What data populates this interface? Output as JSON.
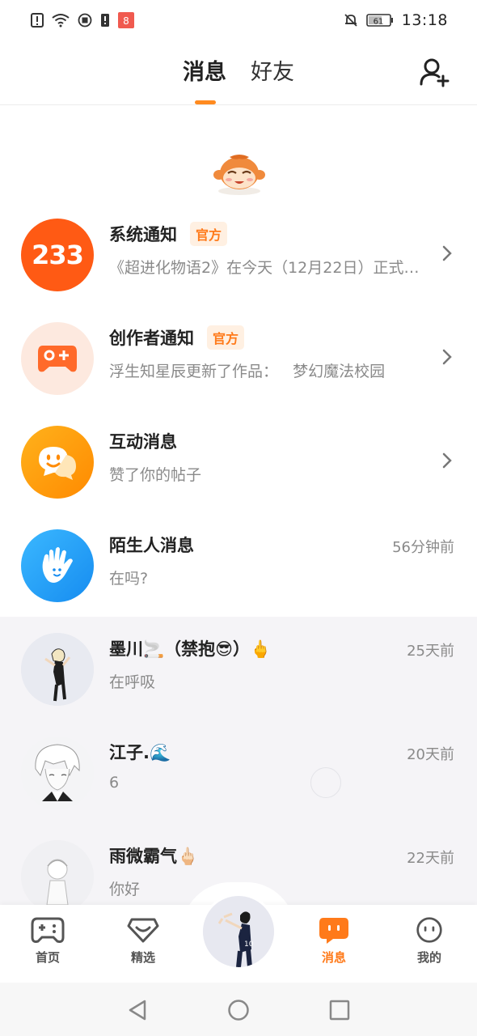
{
  "status_bar": {
    "time": "13:18",
    "battery": "61",
    "icons": [
      "alert-icon",
      "wifi-icon",
      "record-icon",
      "sim-icon",
      "app-badge-icon",
      "mute-bell-icon",
      "battery-icon"
    ]
  },
  "header": {
    "tab_messages": "消息",
    "tab_friends": "好友",
    "active_tab": "消息",
    "add_friend_icon": "add-friend-icon",
    "accent_color": "#ff8a1f"
  },
  "messages": [
    {
      "title": "系统通知",
      "badge": "官方",
      "preview": "《超进化物语2》在今天（12月22日）正式…",
      "avatar_text": "233",
      "icon": "logo-233-icon"
    },
    {
      "title": "创作者通知",
      "badge": "官方",
      "preview": "浮生知星辰更新了作品：   梦幻魔法校园",
      "icon": "gamepad-plus-icon"
    },
    {
      "title": "互动消息",
      "preview": "赞了你的帖子",
      "icon": "chat-bubble-face-icon"
    },
    {
      "title": "陌生人消息",
      "preview": "在吗?",
      "time": "56分钟前",
      "icon": "waving-hand-icon"
    },
    {
      "title": "墨川🚬（禁抱😎）🖕",
      "preview": "在呼吸",
      "time": "25天前"
    },
    {
      "title": "江子.🌊",
      "preview": "6",
      "time": "20天前"
    },
    {
      "title": "雨微霸气🖕🏻",
      "preview": "你好",
      "time": "22天前"
    }
  ],
  "bottom_nav": [
    {
      "label": "首页",
      "icon": "gamepad-icon"
    },
    {
      "label": "精选",
      "icon": "heart-diamond-icon"
    },
    {
      "label": "消息",
      "icon": "message-icon",
      "active": true
    },
    {
      "label": "我的",
      "icon": "face-icon"
    }
  ]
}
